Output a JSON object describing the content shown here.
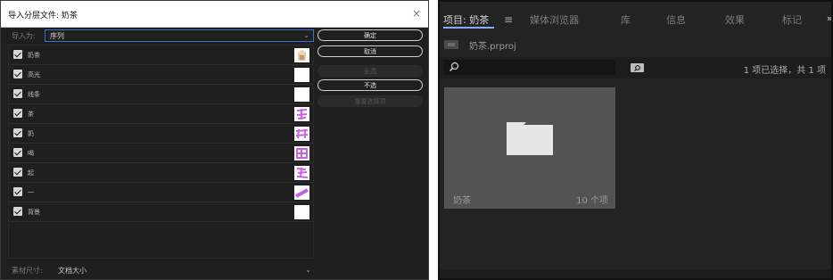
{
  "dialog": {
    "title": "导入分层文件: 奶茶",
    "close_glyph": "×",
    "import_as_label": "导入为:",
    "import_as_value": "序列",
    "layers": [
      {
        "name": "奶茶",
        "checked": true,
        "thumb": "milk-tea-illustration"
      },
      {
        "name": "高光",
        "checked": true,
        "thumb": "blank"
      },
      {
        "name": "线条",
        "checked": true,
        "thumb": "blank"
      },
      {
        "name": "茶",
        "checked": true,
        "thumb": "purple-character"
      },
      {
        "name": "奶",
        "checked": true,
        "thumb": "purple-character"
      },
      {
        "name": "喝",
        "checked": true,
        "thumb": "purple-character"
      },
      {
        "name": "起",
        "checked": true,
        "thumb": "purple-character"
      },
      {
        "name": "一",
        "checked": true,
        "thumb": "purple-stroke"
      },
      {
        "name": "背景",
        "checked": true,
        "thumb": "blank"
      }
    ],
    "footage_size_label": "素材尺寸:",
    "footage_size_value": "文档大小",
    "buttons": {
      "ok": "确定",
      "cancel": "取消",
      "select_all": "全选",
      "select_none": "不选",
      "reset": "重置选择项"
    },
    "accent_color": "#3d6fd1"
  },
  "panel": {
    "tabs": [
      {
        "label": "项目: 奶茶",
        "active": true
      },
      {
        "label": "媒体浏览器",
        "active": false
      },
      {
        "label": "库",
        "active": false
      },
      {
        "label": "信息",
        "active": false
      },
      {
        "label": "效果",
        "active": false
      },
      {
        "label": "标记",
        "active": false
      }
    ],
    "menu_glyph": "≡",
    "more_glyph": "»",
    "project_file": "奶茶.prproj",
    "search_placeholder": "",
    "selection_status": "1 项已选择，共 1 项",
    "items": [
      {
        "name": "奶茶",
        "count": "10 个项",
        "type": "bin"
      }
    ],
    "accent_color": "#7db0ff"
  }
}
